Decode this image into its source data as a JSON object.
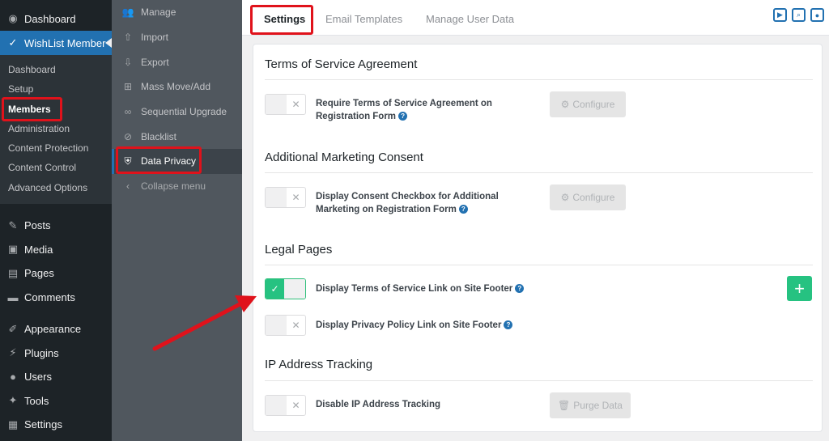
{
  "wp_sidebar": {
    "dashboard": "Dashboard",
    "wishlist": "WishList Member",
    "sub_items": [
      "Dashboard",
      "Setup",
      "Members",
      "Administration",
      "Content Protection",
      "Content Control",
      "Advanced Options"
    ],
    "menu": [
      "Posts",
      "Media",
      "Pages",
      "Comments",
      "Appearance",
      "Plugins",
      "Users",
      "Tools",
      "Settings"
    ]
  },
  "wl_sidebar": {
    "items": [
      "Manage",
      "Import",
      "Export",
      "Mass Move/Add",
      "Sequential Upgrade",
      "Blacklist",
      "Data Privacy"
    ],
    "collapse": "Collapse menu"
  },
  "tabs": [
    "Settings",
    "Email Templates",
    "Manage User Data"
  ],
  "sections": {
    "tos": {
      "title": "Terms of Service Agreement",
      "label": "Require Terms of Service Agreement on Registration Form",
      "button": "Configure"
    },
    "marketing": {
      "title": "Additional Marketing Consent",
      "label": "Display Consent Checkbox for Additional Marketing on Registration Form",
      "button": "Configure"
    },
    "legal": {
      "title": "Legal Pages",
      "tos_link": "Display Terms of Service Link on Site Footer",
      "privacy_link": "Display Privacy Policy Link on Site Footer",
      "add": "+"
    },
    "ip": {
      "title": "IP Address Tracking",
      "label": "Disable IP Address Tracking",
      "button": "Purge Data"
    }
  },
  "colors": {
    "accent": "#2271b1",
    "success": "#26c281",
    "highlight": "#e0121b"
  }
}
